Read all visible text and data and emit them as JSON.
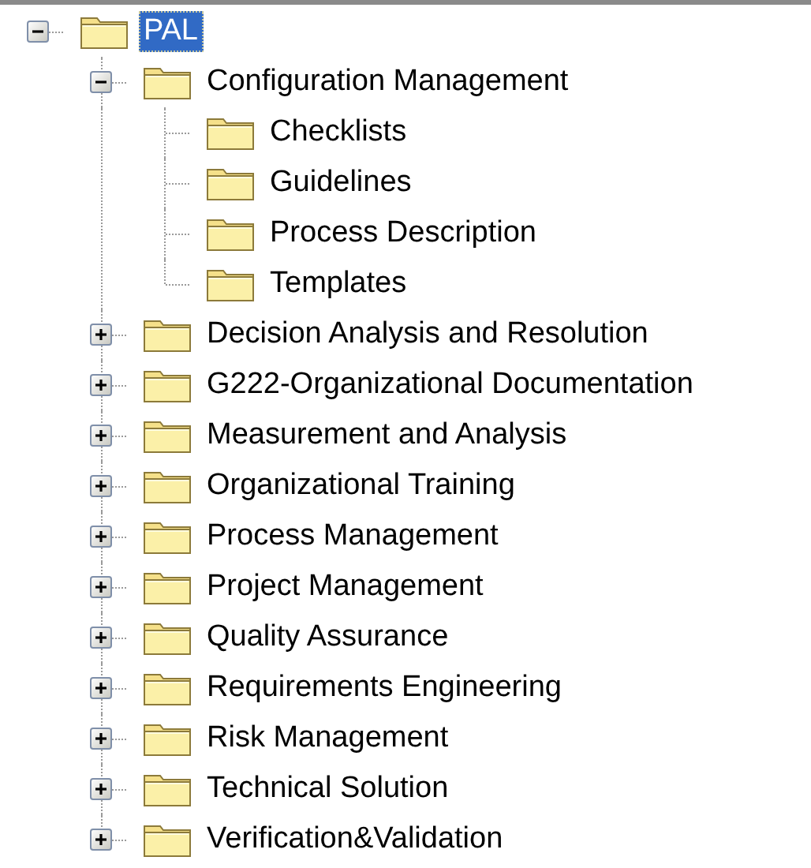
{
  "tree": [
    {
      "label": "PAL",
      "selected": true,
      "expanded": true,
      "children": [
        {
          "label": "Configuration Management",
          "selected": false,
          "expanded": true,
          "children": [
            {
              "label": "Checklists",
              "selected": false
            },
            {
              "label": "Guidelines",
              "selected": false
            },
            {
              "label": "Process Description",
              "selected": false
            },
            {
              "label": "Templates",
              "selected": false
            }
          ]
        },
        {
          "label": "Decision Analysis and Resolution",
          "selected": false,
          "expanded": false
        },
        {
          "label": "G222-Organizational Documentation",
          "selected": false,
          "expanded": false
        },
        {
          "label": "Measurement and Analysis",
          "selected": false,
          "expanded": false
        },
        {
          "label": "Organizational Training",
          "selected": false,
          "expanded": false
        },
        {
          "label": "Process Management",
          "selected": false,
          "expanded": false
        },
        {
          "label": "Project Management",
          "selected": false,
          "expanded": false
        },
        {
          "label": "Quality Assurance",
          "selected": false,
          "expanded": false
        },
        {
          "label": "Requirements Engineering",
          "selected": false,
          "expanded": false
        },
        {
          "label": "Risk Management",
          "selected": false,
          "expanded": false
        },
        {
          "label": "Technical Solution",
          "selected": false,
          "expanded": false
        },
        {
          "label": "Verification&Validation",
          "selected": false,
          "expanded": false
        }
      ]
    }
  ]
}
